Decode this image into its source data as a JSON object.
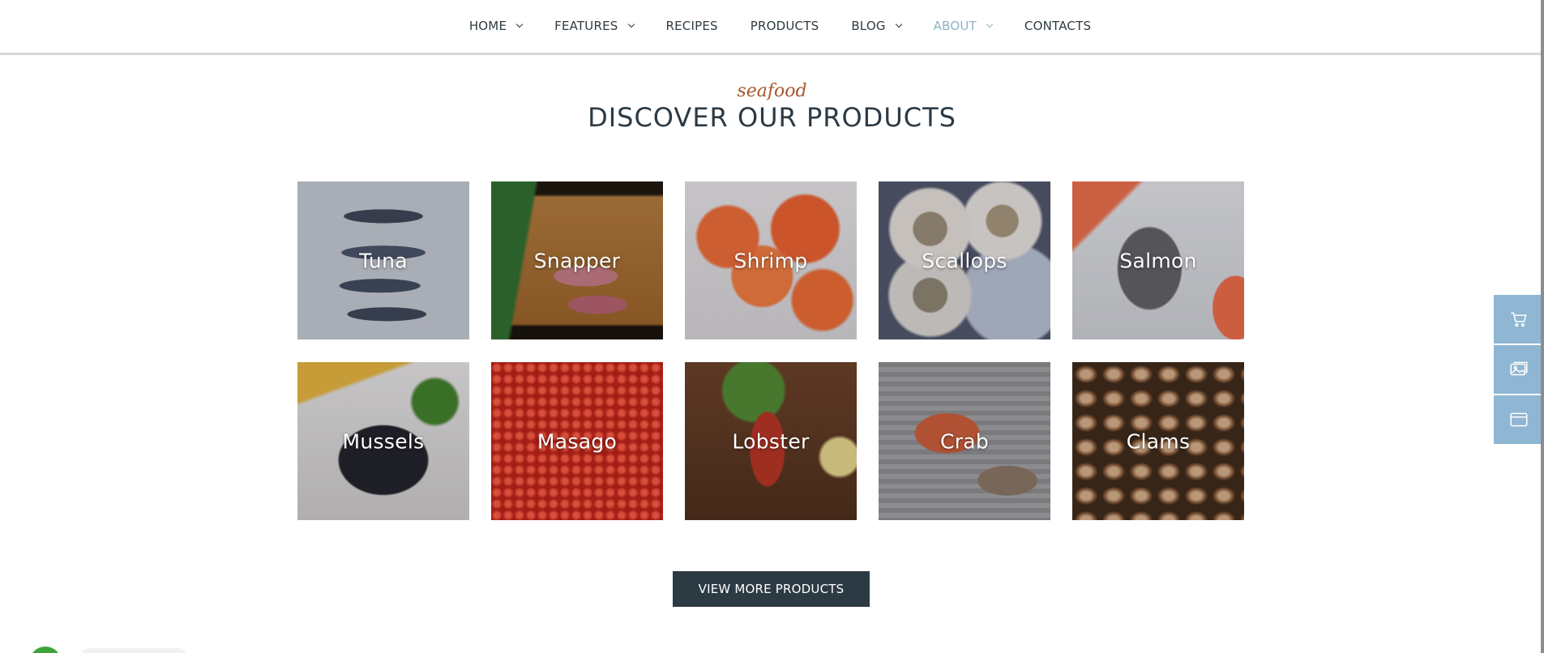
{
  "nav": {
    "items": [
      {
        "label": "HOME",
        "dropdown": true,
        "active": false
      },
      {
        "label": "FEATURES",
        "dropdown": true,
        "active": false
      },
      {
        "label": "RECIPES",
        "dropdown": false,
        "active": false
      },
      {
        "label": "PRODUCTS",
        "dropdown": false,
        "active": false
      },
      {
        "label": "BLOG",
        "dropdown": true,
        "active": false
      },
      {
        "label": "ABOUT",
        "dropdown": true,
        "active": true
      },
      {
        "label": "CONTACTS",
        "dropdown": false,
        "active": false
      }
    ]
  },
  "section": {
    "kicker": "seafood",
    "title": "DISCOVER OUR PRODUCTS"
  },
  "products": [
    {
      "name": "Tuna"
    },
    {
      "name": "Snapper"
    },
    {
      "name": "Shrimp"
    },
    {
      "name": "Scallops"
    },
    {
      "name": "Salmon"
    },
    {
      "name": "Mussels"
    },
    {
      "name": "Masago"
    },
    {
      "name": "Lobster"
    },
    {
      "name": "Crab"
    },
    {
      "name": "Clams"
    }
  ],
  "cta": {
    "label": "VIEW MORE PRODUCTS"
  },
  "side_panel": {
    "icons": [
      "cart-icon",
      "gallery-icon",
      "browser-window-icon"
    ]
  },
  "colors": {
    "accent": "#8fb1c6",
    "kicker": "#a8572d",
    "button_bg": "#2c3a44",
    "side_panel": "#8fb6d3"
  }
}
